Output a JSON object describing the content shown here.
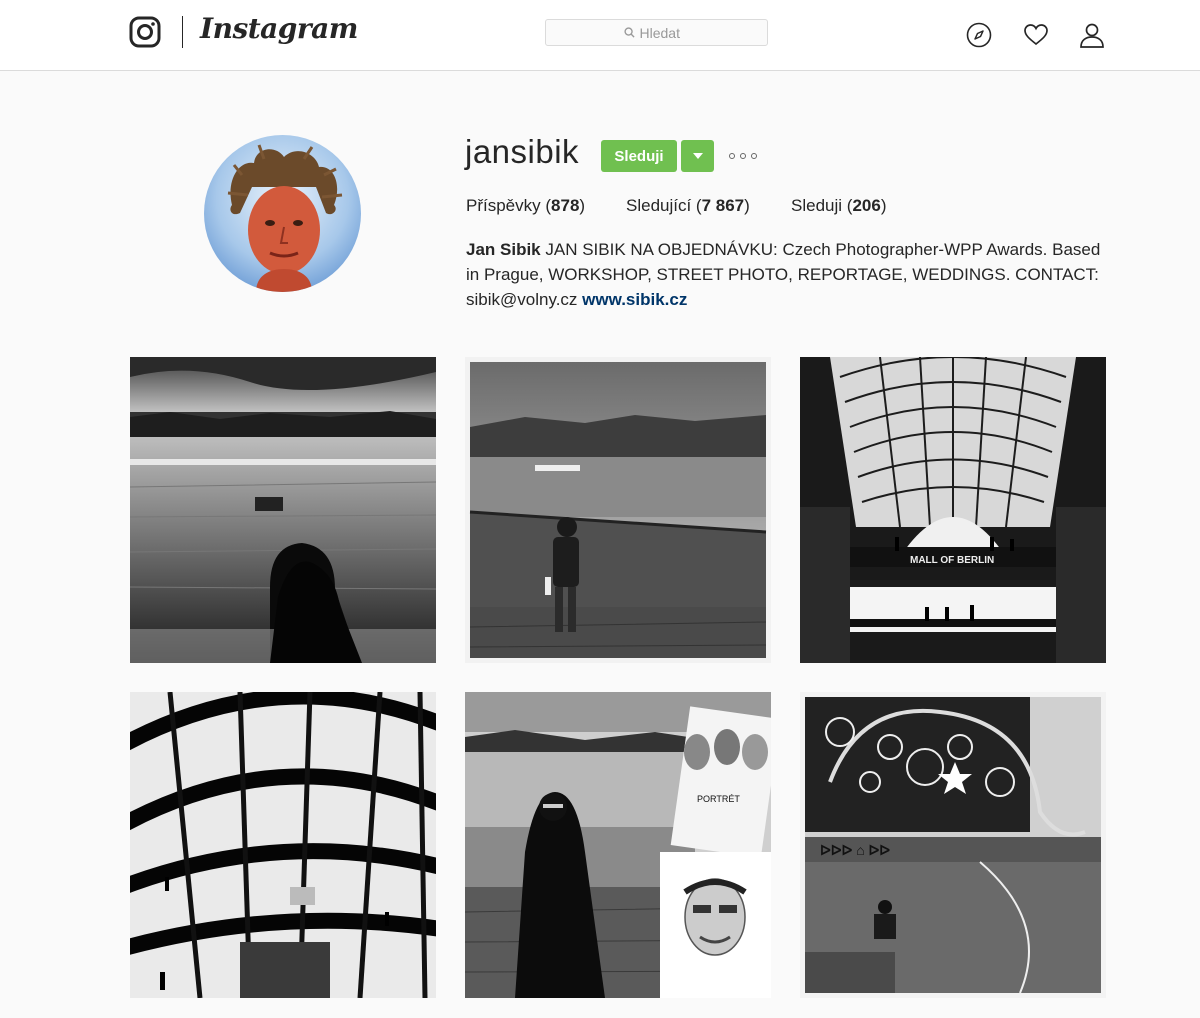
{
  "header": {
    "logo_text": "Instagram",
    "search_placeholder": "Hledat",
    "icons": [
      "instagram-glyph-icon",
      "search-icon",
      "compass-icon",
      "heart-icon",
      "user-icon"
    ]
  },
  "profile": {
    "username": "jansibik",
    "follow_label": "Sleduji",
    "posts_label": "Příspěvky",
    "posts_count": "878",
    "followers_label": "Sledující",
    "followers_count": "7 867",
    "following_label": "Sleduji",
    "following_count": "206",
    "full_name": "Jan Sibik",
    "bio_text": "JAN SIBIK NA OBJEDNÁVKU: Czech Photographer-WPP Awards. Based in Prague, WORKSHOP, STREET PHOTO, REPORTAGE, WEDDINGS. CONTACT: sibik@volny.cz",
    "website": "www.sibik.cz"
  },
  "posts": [
    {
      "description": "river-bridge-photo"
    },
    {
      "description": "child-on-bridge-photo"
    },
    {
      "description": "mall-of-berlin-photo",
      "sign_text": "MALL OF BERLIN"
    },
    {
      "description": "reichstag-dome-photo"
    },
    {
      "description": "portrait-artist-photo",
      "sign_text": "PORTRÉT"
    },
    {
      "description": "elephant-mural-photo"
    }
  ],
  "colors": {
    "follow_green": "#70c050",
    "link_blue": "#003569",
    "border": "#dbdbdb",
    "background": "#fafafa"
  }
}
